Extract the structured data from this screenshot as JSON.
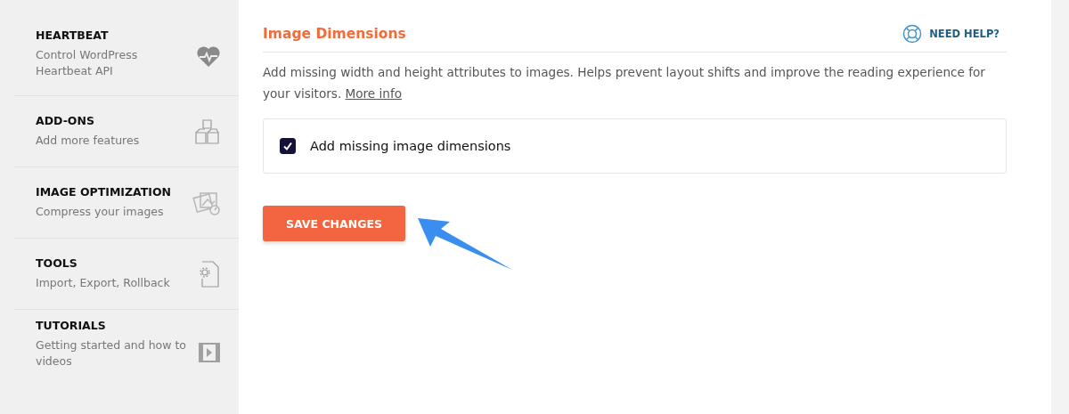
{
  "sidebar": {
    "items": [
      {
        "title": "HEARTBEAT",
        "subtitle": "Control WordPress Heartbeat API"
      },
      {
        "title": "ADD-ONS",
        "subtitle": "Add more features"
      },
      {
        "title": "IMAGE OPTIMIZATION",
        "subtitle": "Compress your images"
      },
      {
        "title": "TOOLS",
        "subtitle": "Import, Export, Rollback"
      },
      {
        "title": "TUTORIALS",
        "subtitle": "Getting started and how to videos"
      }
    ]
  },
  "section": {
    "title": "Image Dimensions",
    "help_link": "NEED HELP?",
    "description": "Add missing width and height attributes to images. Helps prevent layout shifts and improve the reading experience for your visitors.",
    "more_link": "More info",
    "options": [
      {
        "label": "Add missing image dimensions",
        "checked": true
      }
    ],
    "save_button": "SAVE CHANGES"
  }
}
